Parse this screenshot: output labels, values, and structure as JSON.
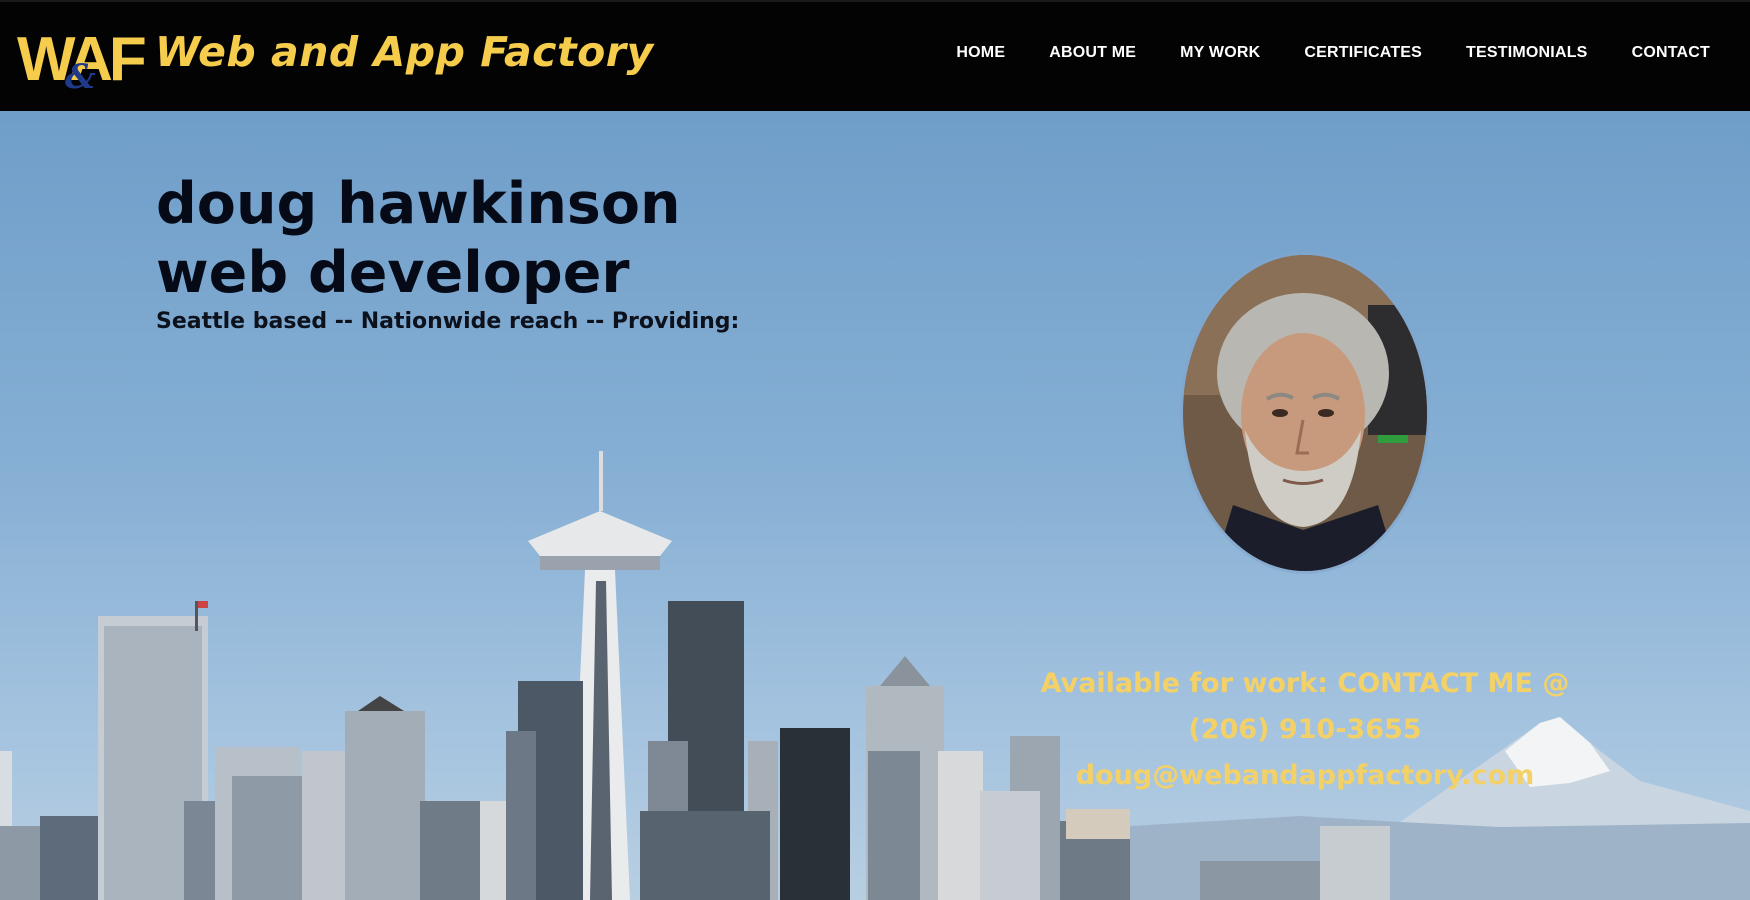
{
  "brand": {
    "name": "Web and App Factory",
    "logo_text": "WAF",
    "logo_ampersand": "&"
  },
  "nav": {
    "items": [
      {
        "label": "HOME"
      },
      {
        "label": "ABOUT ME"
      },
      {
        "label": "MY WORK"
      },
      {
        "label": "CERTIFICATES"
      },
      {
        "label": "TESTIMONIALS"
      },
      {
        "label": "CONTACT"
      }
    ]
  },
  "hero": {
    "name": "doug hawkinson",
    "role": "web developer",
    "tagline": "Seattle based -- Nationwide reach -- Providing:"
  },
  "contact": {
    "line1": "Available for work: CONTACT ME @",
    "phone": "(206) 910-3655",
    "email": "doug@webandappfactory.com"
  },
  "colors": {
    "header_bg": "#030303",
    "brand_gold": "#f5cc4c",
    "contact_gold": "#f4d166",
    "title_dark": "#050a16"
  },
  "icons": {
    "logo": "waf-logo-icon",
    "portrait": "profile-photo"
  }
}
